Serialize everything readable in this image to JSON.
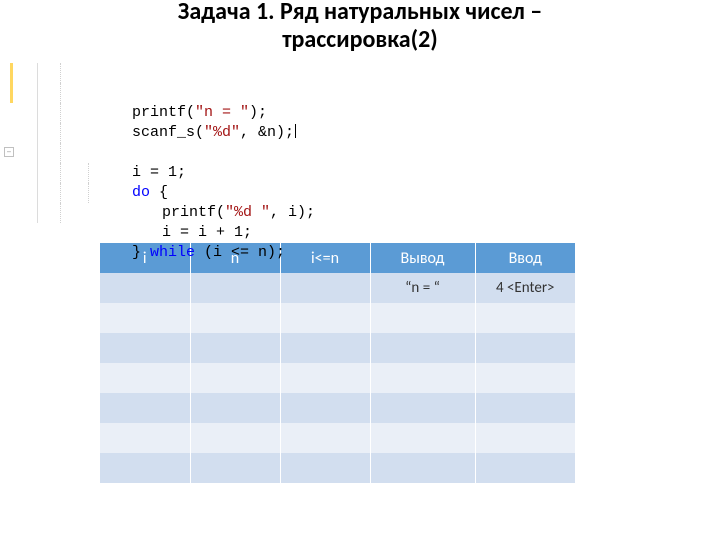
{
  "title_line1": "Задача 1. Ряд натуральных чисел –",
  "title_line2": "трассировка(2)",
  "code": {
    "l1a": "printf(",
    "l1b": "\"n = \"",
    "l1c": ");",
    "l2a": "scanf_s(",
    "l2b": "\"%d\"",
    "l2c": ", &n);",
    "l4a": "i = 1;",
    "l5a": "do",
    "l5b": " {",
    "l6a": "printf(",
    "l6b": "\"%d \"",
    "l6c": ", i);",
    "l7a": "i = i + 1;",
    "l8a": "} ",
    "l8b": "while",
    "l8c": " (i <= n);"
  },
  "table": {
    "headers": {
      "i": "i",
      "n": "n",
      "cond": "i<=n",
      "out": "Вывод",
      "in": "Ввод"
    },
    "rows": [
      {
        "i": "",
        "n": "",
        "cond": "",
        "out": "“n = “",
        "in": "4 <Enter>"
      },
      {
        "i": "",
        "n": "",
        "cond": "",
        "out": "",
        "in": ""
      },
      {
        "i": "",
        "n": "",
        "cond": "",
        "out": "",
        "in": ""
      },
      {
        "i": "",
        "n": "",
        "cond": "",
        "out": "",
        "in": ""
      },
      {
        "i": "",
        "n": "",
        "cond": "",
        "out": "",
        "in": ""
      },
      {
        "i": "",
        "n": "",
        "cond": "",
        "out": "",
        "in": ""
      },
      {
        "i": "",
        "n": "",
        "cond": "",
        "out": "",
        "in": ""
      }
    ]
  }
}
